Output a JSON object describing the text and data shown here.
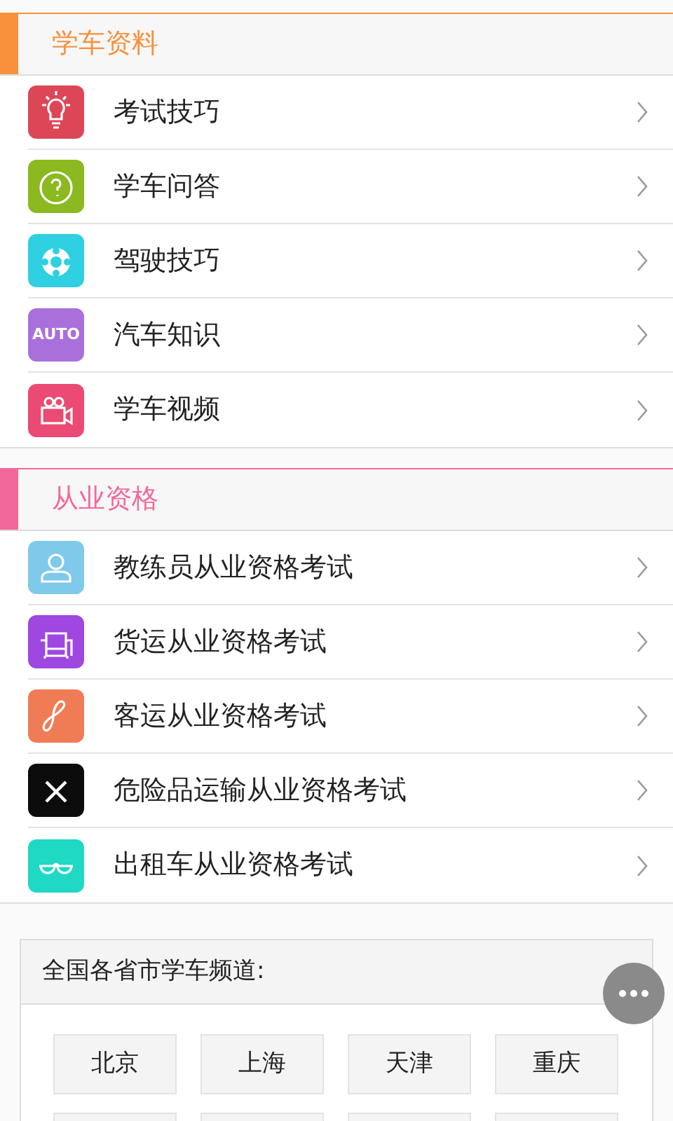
{
  "sections": [
    {
      "title": "学车资料",
      "color": "#f7913c",
      "items": [
        {
          "label": "考试技巧",
          "kind": "bulb",
          "color": "#dd4656"
        },
        {
          "label": "学车问答",
          "kind": "question",
          "color": "#8bb91f"
        },
        {
          "label": "驾驶技巧",
          "kind": "wheel",
          "color": "#2ed0e2"
        },
        {
          "label": "汽车知识",
          "kind": "auto",
          "color": "#a96fdb",
          "icon_text": "AUTO"
        },
        {
          "label": "学车视频",
          "kind": "camera",
          "color": "#ea4a73"
        }
      ]
    },
    {
      "title": "从业资格",
      "color": "#f2679a",
      "items": [
        {
          "label": "教练员从业资格考试",
          "kind": "person",
          "color": "#7fc9ea"
        },
        {
          "label": "货运从业资格考试",
          "kind": "sofa",
          "color": "#9e47e1"
        },
        {
          "label": "客运从业资格考试",
          "kind": "infinity",
          "color": "#f07c55"
        },
        {
          "label": "危险品运输从业资格考试",
          "kind": "cross",
          "color": "#0c0c0c"
        },
        {
          "label": "出租车从业资格考试",
          "kind": "glasses",
          "color": "#1fd9c4"
        }
      ]
    }
  ],
  "city_panel": {
    "title": "全国各省市学车频道:",
    "cities": [
      "北京",
      "上海",
      "天津",
      "重庆"
    ]
  }
}
